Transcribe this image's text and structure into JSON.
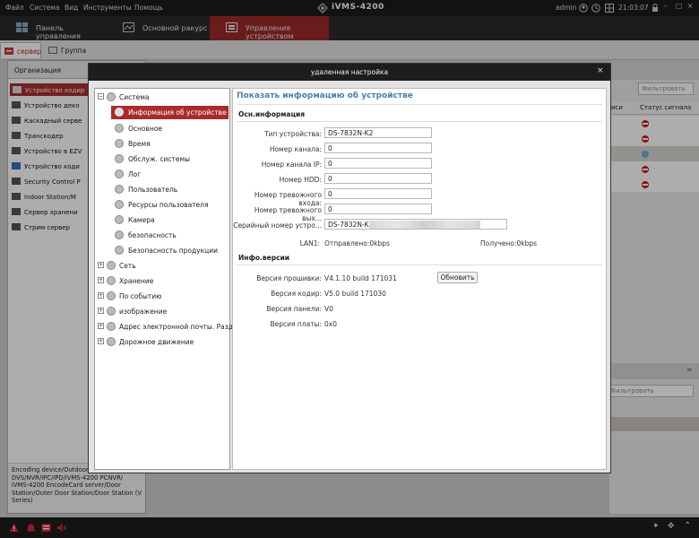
{
  "menubar": {
    "items": [
      "Файл",
      "Система",
      "Вид",
      "Инструменты",
      "Помощь"
    ],
    "app_title": "iVMS-4200",
    "user": "admin",
    "time": "21:03:07"
  },
  "navbar": {
    "tabs": [
      "Панель управления",
      "Основной ракурс",
      "Управления устройством"
    ]
  },
  "subbar": {
    "tabs": [
      "сервер",
      "Группа"
    ]
  },
  "left_panel": {
    "header": "Организация",
    "items": [
      "Устройство кодир",
      "Устройство деко",
      "Каскадный серве",
      "Транскодер",
      "Устройство в EZV",
      "Устройство коди",
      "Security Control P",
      "Indoor Station/M",
      "Сервер хранени",
      "Стрим сервер"
    ],
    "description": "Encoding device/Outdoor DVS/NVR/IPC/IPD/iVMS-4200 PCNVR/ iVMS-4200 EncodeCard server/Door Station/Outer Door Station/Door Station (V Series)"
  },
  "right_panel": {
    "filter_placeholder": "Фильтровать",
    "col_left": "иси",
    "col_status": "Статус сигнала",
    "filter2_placeholder": "Фильтровать"
  },
  "dialog": {
    "title": "удаленная настройка",
    "close": "×",
    "tree": {
      "root": "Система",
      "children": [
        "Информация об устройстве",
        "Основное",
        "Время",
        "Обслуж. системы",
        "Лог",
        "Пользователь",
        "Ресурсы пользователя",
        "Камера",
        "безопасность",
        "Безопасность продукции"
      ],
      "groups": [
        "Сеть",
        "Хранение",
        "По событию",
        "изображение",
        "Адрес электронной почты. Раздел...",
        "Дорожное движение"
      ]
    },
    "content": {
      "heading": "Показать информацию об устройстве",
      "basic_section": "Осн.информация",
      "fields": [
        {
          "label": "Тип устройства:",
          "value": "DS-7832N-K2"
        },
        {
          "label": "Номер канала:",
          "value": "0"
        },
        {
          "label": "Номер канала IP:",
          "value": "0"
        },
        {
          "label": "Номер HDD:",
          "value": "0"
        },
        {
          "label": "Номер тревожного входа:",
          "value": "0"
        },
        {
          "label": "Номер тревожного вых...",
          "value": "0"
        },
        {
          "label": "Серийный номер устро...",
          "value": "DS-7832N-K2"
        }
      ],
      "lan_label": "LAN1:",
      "lan_sent": "Отправлено:0kbps",
      "lan_received": "Получено:0kbps",
      "version_section": "Инфо.версии",
      "versions": [
        {
          "label": "Версия прошивки:",
          "value": "V4.1.10 build 171031"
        },
        {
          "label": "Версия кодир:",
          "value": "V5.0 build 171030"
        },
        {
          "label": "Версия панели:",
          "value": "V0"
        },
        {
          "label": "Версия платы:",
          "value": "0x0"
        }
      ],
      "update_button": "Обновить"
    }
  },
  "colors": {
    "accent_red": "#a82c2c",
    "heading_blue": "#4a7fb0",
    "menubar_bg": "#1b1b1b"
  }
}
